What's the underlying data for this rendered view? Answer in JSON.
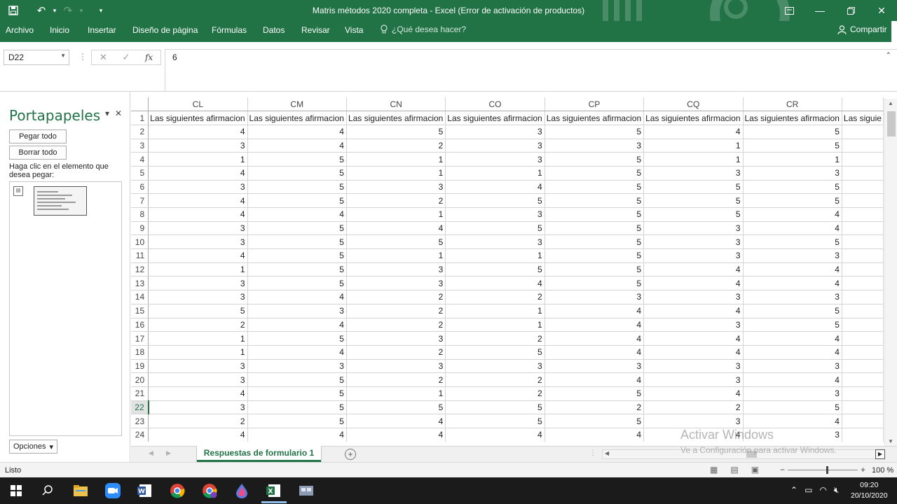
{
  "window": {
    "title": "Matris métodos 2020 completa - Excel (Error de activación de productos)",
    "qat": {
      "save_icon": "floppy-disk-icon",
      "undo_icon": "undo-icon",
      "redo_icon": "redo-icon",
      "customize_icon": "chevron-down-icon"
    }
  },
  "ribbon": {
    "tabs": [
      "Archivo",
      "Inicio",
      "Insertar",
      "Diseño de página",
      "Fórmulas",
      "Datos",
      "Revisar",
      "Vista"
    ],
    "tell_me": "¿Qué desea hacer?",
    "share": "Compartir"
  },
  "formula_bar": {
    "name_box": "D22",
    "value": "6"
  },
  "clipboard": {
    "title": "Portapapeles",
    "paste_all": "Pegar todo",
    "clear_all": "Borrar todo",
    "hint": "Haga clic en el elemento que desea pegar:",
    "options": "Opciones"
  },
  "sheet": {
    "columns": [
      "CL",
      "CM",
      "CN",
      "CO",
      "CP",
      "CQ",
      "CR",
      ""
    ],
    "header_text": "Las siguientes afirmacion",
    "header_text_partial": "Las siguie",
    "rows": [
      {
        "n": "2",
        "v": [
          "4",
          "4",
          "5",
          "3",
          "5",
          "4",
          "5"
        ]
      },
      {
        "n": "3",
        "v": [
          "3",
          "4",
          "2",
          "3",
          "3",
          "1",
          "5"
        ]
      },
      {
        "n": "4",
        "v": [
          "1",
          "5",
          "1",
          "3",
          "5",
          "1",
          "1"
        ]
      },
      {
        "n": "5",
        "v": [
          "4",
          "5",
          "1",
          "1",
          "5",
          "3",
          "3"
        ]
      },
      {
        "n": "6",
        "v": [
          "3",
          "5",
          "3",
          "4",
          "5",
          "5",
          "5"
        ]
      },
      {
        "n": "7",
        "v": [
          "4",
          "5",
          "2",
          "5",
          "5",
          "5",
          "5"
        ]
      },
      {
        "n": "8",
        "v": [
          "4",
          "4",
          "1",
          "3",
          "5",
          "5",
          "4"
        ]
      },
      {
        "n": "9",
        "v": [
          "3",
          "5",
          "4",
          "5",
          "5",
          "3",
          "4"
        ]
      },
      {
        "n": "10",
        "v": [
          "3",
          "5",
          "5",
          "3",
          "5",
          "3",
          "5"
        ]
      },
      {
        "n": "11",
        "v": [
          "4",
          "5",
          "1",
          "1",
          "5",
          "3",
          "3"
        ]
      },
      {
        "n": "12",
        "v": [
          "1",
          "5",
          "3",
          "5",
          "5",
          "4",
          "4"
        ]
      },
      {
        "n": "13",
        "v": [
          "3",
          "5",
          "3",
          "4",
          "5",
          "4",
          "4"
        ]
      },
      {
        "n": "14",
        "v": [
          "3",
          "4",
          "2",
          "2",
          "3",
          "3",
          "3"
        ]
      },
      {
        "n": "15",
        "v": [
          "5",
          "3",
          "2",
          "1",
          "4",
          "4",
          "5"
        ]
      },
      {
        "n": "16",
        "v": [
          "2",
          "4",
          "2",
          "1",
          "4",
          "3",
          "5"
        ]
      },
      {
        "n": "17",
        "v": [
          "1",
          "5",
          "3",
          "2",
          "4",
          "4",
          "4"
        ]
      },
      {
        "n": "18",
        "v": [
          "1",
          "4",
          "2",
          "5",
          "4",
          "4",
          "4"
        ]
      },
      {
        "n": "19",
        "v": [
          "3",
          "3",
          "3",
          "3",
          "3",
          "3",
          "3"
        ]
      },
      {
        "n": "20",
        "v": [
          "3",
          "5",
          "2",
          "2",
          "4",
          "3",
          "4"
        ]
      },
      {
        "n": "21",
        "v": [
          "4",
          "5",
          "1",
          "2",
          "5",
          "4",
          "3"
        ]
      },
      {
        "n": "22",
        "v": [
          "3",
          "5",
          "5",
          "5",
          "2",
          "2",
          "5"
        ]
      },
      {
        "n": "23",
        "v": [
          "2",
          "5",
          "4",
          "5",
          "5",
          "3",
          "4"
        ]
      },
      {
        "n": "24",
        "v": [
          "4",
          "4",
          "4",
          "4",
          "4",
          "4",
          "3"
        ]
      }
    ],
    "active_row": "22",
    "tab_name": "Respuestas de formulario 1"
  },
  "watermark": {
    "line1": "Activar Windows",
    "line2": "Ve a Configuración para activar Windows."
  },
  "status": {
    "ready": "Listo",
    "zoom": "100 %"
  },
  "taskbar": {
    "time": "09:20",
    "date": "20/10/2020",
    "apps": [
      "start-icon",
      "search-icon",
      "file-explorer-icon",
      "zoom-icon",
      "word-icon",
      "chrome-icon",
      "chrome-profile-icon",
      "paint-icon",
      "excel-icon",
      "network-app-icon"
    ]
  },
  "colors": {
    "accent": "#217346",
    "taskbar": "#1b1b1b"
  }
}
